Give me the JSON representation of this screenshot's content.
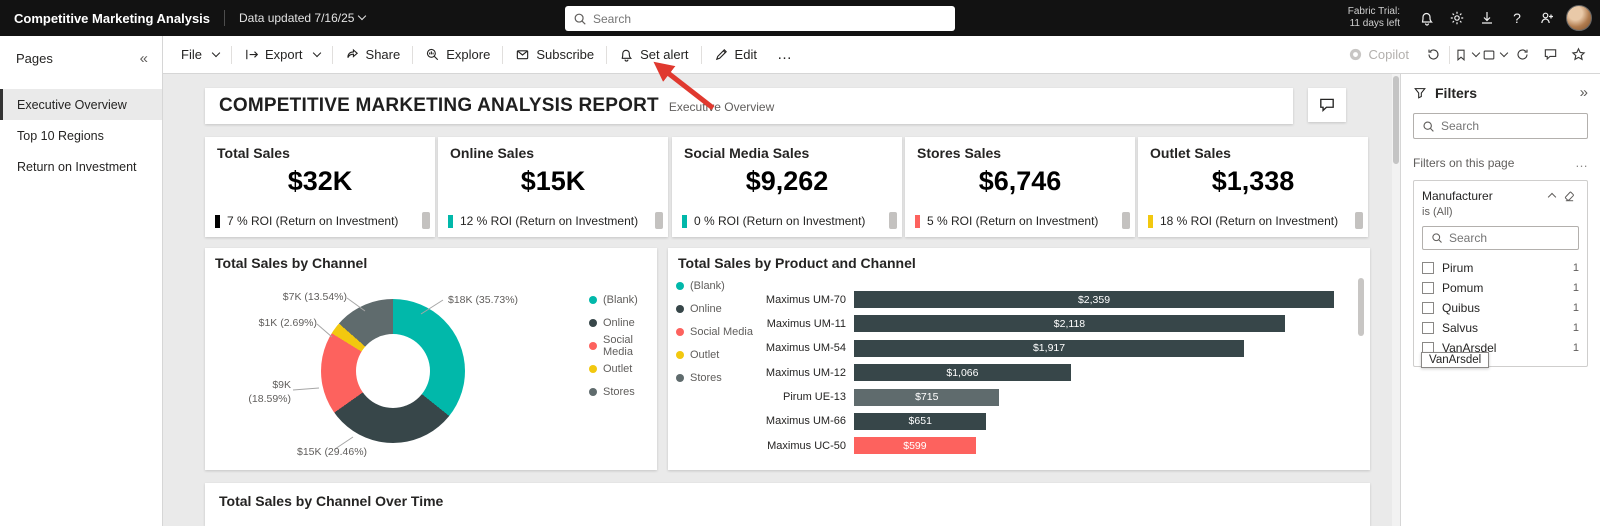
{
  "icons": {
    "pages_collapse": "«",
    "filters_collapse": "»",
    "toolbar_more": "…",
    "filters_more": "…",
    "help": "?"
  },
  "topbar": {
    "app_title": "Competitive Marketing Analysis",
    "data_updated": "Data updated 7/16/25",
    "search_placeholder": "Search",
    "trial_line1": "Fabric Trial:",
    "trial_line2": "11 days left"
  },
  "pages": {
    "title": "Pages",
    "items": [
      {
        "label": "Executive Overview"
      },
      {
        "label": "Top 10 Regions"
      },
      {
        "label": "Return on Investment"
      }
    ]
  },
  "toolbar": {
    "file": "File",
    "export": "Export",
    "share": "Share",
    "explore": "Explore",
    "subscribe": "Subscribe",
    "set_alert": "Set alert",
    "edit": "Edit",
    "copilot": "Copilot"
  },
  "report": {
    "title": "COMPETITIVE MARKETING ANALYSIS REPORT",
    "subtitle": "Executive Overview",
    "kpis": [
      {
        "title": "Total Sales",
        "value": "$32K",
        "roi": "7 % ROI (Return on Investment)",
        "marker_color": "#000000"
      },
      {
        "title": "Online Sales",
        "value": "$15K",
        "roi": "12 % ROI (Return on Investment)",
        "marker_color": "#01b8aa"
      },
      {
        "title": "Social Media Sales",
        "value": "$9,262",
        "roi": "0 % ROI (Return on Investment)",
        "marker_color": "#01b8aa"
      },
      {
        "title": "Stores Sales",
        "value": "$6,746",
        "roi": "5 % ROI (Return on Investment)",
        "marker_color": "#fd625e"
      },
      {
        "title": "Outlet Sales",
        "value": "$1,338",
        "roi": "18 % ROI (Return on Investment)",
        "marker_color": "#f2c80f"
      }
    ],
    "bottom_section_title": "Total Sales by Channel Over Time"
  },
  "chart_data": [
    {
      "type": "pie",
      "title": "Total Sales by Channel",
      "legend_position": "right",
      "slices": [
        {
          "label": "(Blank)",
          "value_label": "$18K",
          "pct": 35.73,
          "color": "#01b8aa",
          "callout": "$18K (35.73%)"
        },
        {
          "label": "Online",
          "value_label": "$15K",
          "pct": 29.46,
          "color": "#374649",
          "callout": "$15K (29.46%)"
        },
        {
          "label": "Social Media",
          "value_label": "$9K",
          "pct": 18.59,
          "color": "#fd625e",
          "callout": "$9K (18.59%)"
        },
        {
          "label": "Outlet",
          "value_label": "$1K",
          "pct": 2.69,
          "color": "#f2c80f",
          "callout": "$1K (2.69%)"
        },
        {
          "label": "Stores",
          "value_label": "$7K",
          "pct": 13.54,
          "color": "#5f6b6d",
          "callout": "$7K (13.54%)"
        }
      ]
    },
    {
      "type": "bar",
      "title": "Total Sales by Product and Channel",
      "legend_position": "left",
      "legend": [
        {
          "label": "(Blank)",
          "color": "#01b8aa"
        },
        {
          "label": "Online",
          "color": "#374649"
        },
        {
          "label": "Social Media",
          "color": "#fd625e"
        },
        {
          "label": "Outlet",
          "color": "#f2c80f"
        },
        {
          "label": "Stores",
          "color": "#5f6b6d"
        }
      ],
      "xmax": 2359,
      "bars": [
        {
          "category": "Maximus UM-70",
          "value": 2359,
          "label": "$2,359",
          "color": "#374649"
        },
        {
          "category": "Maximus UM-11",
          "value": 2118,
          "label": "$2,118",
          "color": "#374649"
        },
        {
          "category": "Maximus UM-54",
          "value": 1917,
          "label": "$1,917",
          "color": "#374649"
        },
        {
          "category": "Maximus UM-12",
          "value": 1066,
          "label": "$1,066",
          "color": "#374649"
        },
        {
          "category": "Pirum UE-13",
          "value": 715,
          "label": "$715",
          "color": "#5f6b6d"
        },
        {
          "category": "Maximus UM-66",
          "value": 651,
          "label": "$651",
          "color": "#374649"
        },
        {
          "category": "Maximus UC-50",
          "value": 599,
          "label": "$599",
          "color": "#fd625e"
        }
      ]
    }
  ],
  "filters": {
    "title": "Filters",
    "search_placeholder": "Search",
    "section_label": "Filters on this page",
    "card": {
      "field": "Manufacturer",
      "condition": "is (All)",
      "search_placeholder": "Search",
      "values": [
        {
          "label": "Pirum",
          "count": "1"
        },
        {
          "label": "Pomum",
          "count": "1"
        },
        {
          "label": "Quibus",
          "count": "1"
        },
        {
          "label": "Salvus",
          "count": "1"
        },
        {
          "label": "VanArsdel",
          "count": "1"
        }
      ],
      "tooltip": "VanArsdel"
    }
  }
}
